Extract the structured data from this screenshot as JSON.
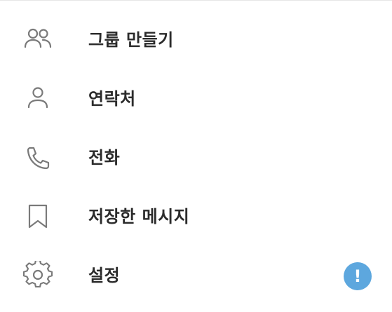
{
  "menu": {
    "items": [
      {
        "id": "new-group",
        "label": "그룹 만들기",
        "icon": "users-icon"
      },
      {
        "id": "contacts",
        "label": "연락처",
        "icon": "user-icon"
      },
      {
        "id": "calls",
        "label": "전화",
        "icon": "phone-icon"
      },
      {
        "id": "saved-messages",
        "label": "저장한 메시지",
        "icon": "bookmark-icon"
      },
      {
        "id": "settings",
        "label": "설정",
        "icon": "gear-icon",
        "badge": "!"
      }
    ]
  },
  "colors": {
    "icon": "#7a7a7a",
    "text": "#2b2b2b",
    "badge": "#5da7de",
    "divider": "#e6e6e6",
    "background": "#ffffff"
  }
}
